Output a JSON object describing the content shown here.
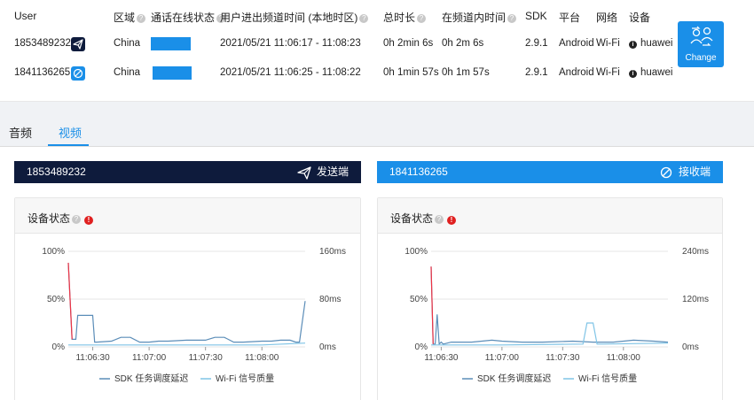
{
  "table": {
    "headers": {
      "user": "User",
      "region": "区域",
      "online_status": "通话在线状态",
      "enter_exit_time": "用户进出频道时间 (本地时区)",
      "total_duration": "总时长",
      "in_channel_time": "在频道内时间",
      "sdk": "SDK",
      "platform": "平台",
      "network": "网络",
      "device": "设备"
    },
    "rows": [
      {
        "user": "1853489232",
        "role_icon": "send-icon",
        "region": "China",
        "online_fraction": 1.0,
        "time_range": "2021/05/21 11:06:17 - 11:08:23",
        "total_duration": "0h 2min 6s",
        "in_channel_time": "0h 2m 6s",
        "sdk": "2.9.1",
        "platform": "Android",
        "network": "Wi-Fi",
        "device": "huawei"
      },
      {
        "user": "1841136265",
        "role_icon": "receive-icon",
        "region": "China",
        "online_fraction": 0.98,
        "time_range": "2021/05/21 11:06:25 - 11:08:22",
        "total_duration": "0h 1min 57s",
        "in_channel_time": "0h 1m 57s",
        "sdk": "2.9.1",
        "platform": "Android",
        "network": "Wi-Fi",
        "device": "huawei"
      }
    ]
  },
  "change_button": {
    "label": "Change",
    "icon": "switch-users-icon"
  },
  "tabs": [
    {
      "label": "音频",
      "active": false
    },
    {
      "label": "视频",
      "active": true
    }
  ],
  "users": {
    "sender": {
      "id": "1853489232",
      "role": "发送端",
      "icon": "send-icon",
      "color": "#0e1b3c"
    },
    "receiver": {
      "id": "1841136265",
      "role": "接收端",
      "icon": "receive-icon",
      "color": "#1a8fe8"
    }
  },
  "panels": {
    "left_title": "设备状态",
    "right_title": "设备状态"
  },
  "colors": {
    "accent": "#1a8fe8",
    "sdk_series": "#5b8db8",
    "wifi_series": "#7fc4e6",
    "spike": "#ee3344",
    "warning": "#e02020"
  },
  "chart_data": [
    {
      "type": "line",
      "title": "",
      "x_ticks": [
        "11:06:30",
        "11:07:00",
        "11:07:30",
        "11:08:00"
      ],
      "y_left_ticks": [
        "0%",
        "50%",
        "100%"
      ],
      "y_left_range": [
        0,
        100
      ],
      "y_right_ticks": [
        "0ms",
        "80ms",
        "160ms"
      ],
      "y_right_range": [
        0,
        160
      ],
      "grid": true,
      "legend_position": "bottom",
      "legend": [
        "SDK 任务调度延迟",
        "Wi-Fi 信号质量"
      ],
      "series": [
        {
          "name": "SDK 任务调度延迟",
          "x": [
            "11:06:17",
            "11:06:19",
            "11:06:21",
            "11:06:22",
            "11:06:23",
            "11:06:30",
            "11:06:31",
            "11:06:32",
            "11:06:40",
            "11:06:45",
            "11:06:50",
            "11:06:55",
            "11:07:00",
            "11:07:05",
            "11:07:10",
            "11:07:20",
            "11:07:30",
            "11:07:35",
            "11:07:40",
            "11:07:45",
            "11:07:50",
            "11:08:00",
            "11:08:05",
            "11:08:10",
            "11:08:15",
            "11:08:18",
            "11:08:20",
            "11:08:23"
          ],
          "values": [
            88,
            8,
            8,
            33,
            33,
            33,
            5,
            5,
            6,
            10,
            10,
            5,
            5,
            6,
            6,
            7,
            7,
            10,
            10,
            5,
            5,
            6,
            6,
            7,
            7,
            5,
            5,
            48
          ]
        },
        {
          "name": "Wi-Fi 信号质量",
          "x": [
            "11:06:17",
            "11:06:30",
            "11:07:00",
            "11:07:30",
            "11:08:00",
            "11:08:23"
          ],
          "values": [
            2,
            2,
            2,
            2,
            2,
            4
          ]
        }
      ]
    },
    {
      "type": "line",
      "title": "",
      "x_ticks": [
        "11:06:30",
        "11:07:00",
        "11:07:30",
        "11:08:00"
      ],
      "y_left_ticks": [
        "0%",
        "50%",
        "100%"
      ],
      "y_left_range": [
        0,
        100
      ],
      "y_right_ticks": [
        "0ms",
        "120ms",
        "240ms"
      ],
      "y_right_range": [
        0,
        240
      ],
      "grid": true,
      "legend_position": "bottom",
      "legend": [
        "SDK 任务调度延迟",
        "Wi-Fi 信号质量"
      ],
      "series": [
        {
          "name": "SDK 任务调度延迟",
          "x": [
            "11:06:25",
            "11:06:26",
            "11:06:27",
            "11:06:28",
            "11:06:29",
            "11:06:30",
            "11:06:31",
            "11:06:35",
            "11:06:45",
            "11:06:55",
            "11:07:00",
            "11:07:10",
            "11:07:20",
            "11:07:35",
            "11:07:45",
            "11:07:55",
            "11:08:05",
            "11:08:15",
            "11:08:22"
          ],
          "values": [
            84,
            3,
            3,
            34,
            3,
            5,
            3,
            5,
            5,
            7,
            6,
            5,
            5,
            6,
            5,
            5,
            7,
            6,
            5
          ]
        },
        {
          "name": "Wi-Fi 信号质量",
          "x": [
            "11:06:25",
            "11:07:00",
            "11:07:40",
            "11:07:42",
            "11:07:45",
            "11:07:47",
            "11:07:50",
            "11:08:22"
          ],
          "values": [
            2,
            2,
            3,
            25,
            25,
            3,
            3,
            4
          ]
        }
      ]
    }
  ]
}
